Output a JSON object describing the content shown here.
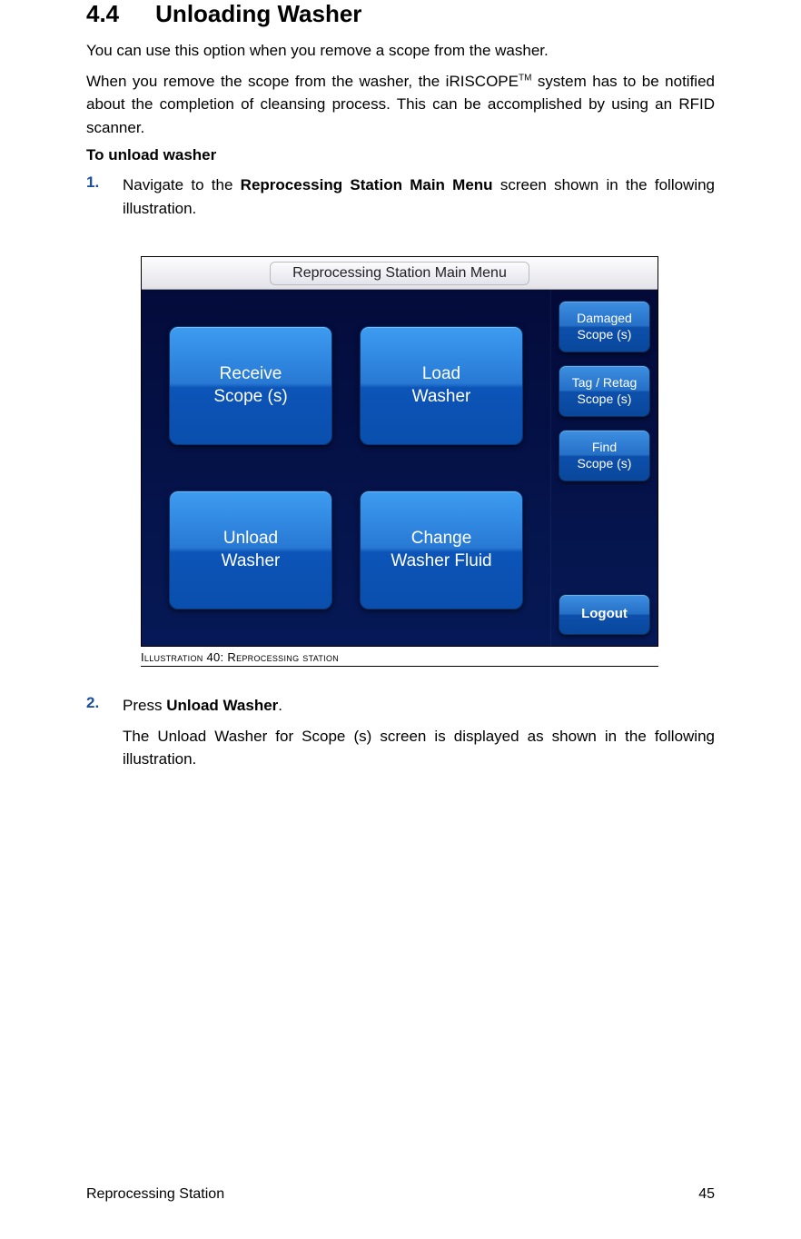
{
  "section": {
    "number": "4.4",
    "title": "Unloading Washer"
  },
  "paragraphs": {
    "p1": "You can use this option when you remove a scope from the washer.",
    "p2_a": "When you remove the scope from  the washer, the  iRISCOPE",
    "p2_sup": "TM",
    "p2_b": " system has to be notified about the completion of cleansing process. This can be accomplished by using an RFID scanner.",
    "subhead": "To unload washer"
  },
  "steps": {
    "s1": {
      "num": "1.",
      "text_a": "Navigate to the ",
      "bold": "Reprocessing Station Main Menu",
      "text_b": " screen shown in the following illustration."
    },
    "s2": {
      "num": "2.",
      "text_a": "Press ",
      "bold": "Unload Washer",
      "text_b": ".",
      "cont_a": "The ",
      "cont_bold": "Unload Washer for Scope (s)",
      "cont_b": " screen is displayed as shown in the following illustration."
    }
  },
  "screenshot": {
    "title": "Reprocessing Station Main Menu",
    "buttons": {
      "receive": "Receive\nScope (s)",
      "load": "Load\nWasher",
      "unload": "Unload\nWasher",
      "change": "Change\nWasher Fluid"
    },
    "side": {
      "damaged": "Damaged\nScope (s)",
      "tag": "Tag / Retag\nScope (s)",
      "find": "Find\nScope (s)",
      "logout": "Logout"
    }
  },
  "caption": {
    "prefix": "Illustration",
    "number": " 40",
    "sep": ": ",
    "rest": "Reprocessing station"
  },
  "footer": {
    "left": "Reprocessing Station",
    "right": "45"
  }
}
